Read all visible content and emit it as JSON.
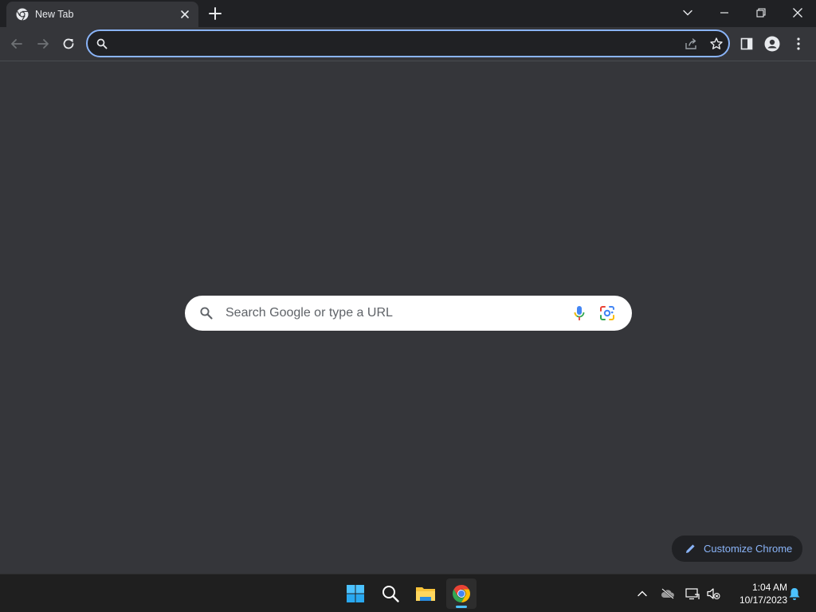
{
  "browser": {
    "tab": {
      "title": "New Tab"
    },
    "omnibox": {
      "value": "",
      "placeholder": ""
    },
    "colors": {
      "frame": "#202124",
      "toolbar": "#35363a",
      "accent": "#8ab4f8",
      "text": "#e8eaed"
    }
  },
  "new_tab_page": {
    "search_placeholder": "Search Google or type a URL",
    "customize_label": "Customize Chrome"
  },
  "icons": {
    "tab_favicon": "chrome-icon",
    "tab_close": "close-icon",
    "new_tab": "plus-icon",
    "tab_search": "chevron-down-icon",
    "minimize": "minimize-icon",
    "restore": "restore-icon",
    "close_window": "close-icon",
    "back": "arrow-left-icon",
    "forward": "arrow-right-icon",
    "reload": "reload-icon",
    "omnibox_search": "search-icon",
    "share": "share-icon",
    "bookmark": "star-icon",
    "side_panel": "side-panel-icon",
    "profile": "person-icon",
    "menu": "more-vert-icon",
    "voice_search": "mic-icon",
    "lens": "lens-icon",
    "customize": "pencil-icon"
  },
  "taskbar": {
    "apps": [
      {
        "name": "start",
        "icon": "windows-icon"
      },
      {
        "name": "search",
        "icon": "search-icon"
      },
      {
        "name": "file-explorer",
        "icon": "folder-icon"
      },
      {
        "name": "chrome",
        "icon": "chrome-icon",
        "active": true
      }
    ],
    "tray": {
      "icons": [
        "chevron-up-icon",
        "cloud-off-icon",
        "network-icon",
        "volume-muted-icon"
      ],
      "time": "1:04 AM",
      "date": "10/17/2023",
      "notification_icon": "bell-icon"
    }
  }
}
